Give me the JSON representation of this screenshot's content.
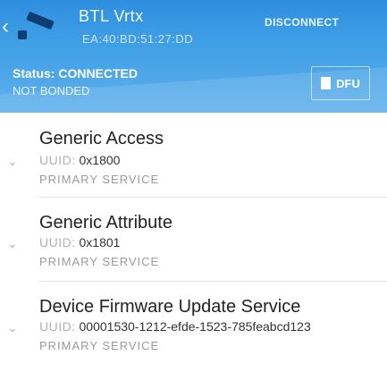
{
  "header": {
    "device_name": "BTL Vrtx",
    "device_mac": "EA:40:BD:51:27:DD",
    "disconnect_label": "DISCONNECT",
    "status": "Status: CONNECTED",
    "bond_state": "NOT BONDED",
    "dfu_label": "DFU",
    "colors": {
      "header_top": "#2f8fe0",
      "header_bottom": "#60b0ec"
    }
  },
  "services": [
    {
      "name": "Generic Access",
      "uuid_prefix": "UUID:",
      "uuid": "0x1800",
      "type": "PRIMARY SERVICE"
    },
    {
      "name": "Generic Attribute",
      "uuid_prefix": "UUID:",
      "uuid": "0x1801",
      "type": "PRIMARY SERVICE"
    },
    {
      "name": "Device Firmware Update Service",
      "uuid_prefix": "UUID:",
      "uuid": "00001530-1212-efde-1523-785feabcd123",
      "type": "PRIMARY SERVICE"
    }
  ]
}
